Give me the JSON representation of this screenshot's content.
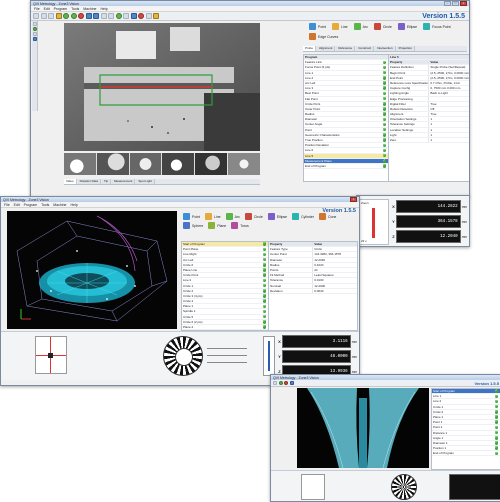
{
  "win1": {
    "title": "QVI Metrology - Zone3 Vision",
    "menu": [
      "File",
      "Edit",
      "Program",
      "Tools",
      "Machine",
      "Help"
    ],
    "version": "Version 1.5.5",
    "features": [
      {
        "label": "Point",
        "icon": "point-icon"
      },
      {
        "label": "Line",
        "icon": "line-icon"
      },
      {
        "label": "Arc",
        "icon": "arc-icon"
      },
      {
        "label": "Circle",
        "icon": "circle-icon"
      },
      {
        "label": "Ellipse",
        "icon": "ellipse-icon"
      },
      {
        "label": "Focus Point",
        "icon": "focus-point-icon"
      },
      {
        "label": "Edge Curves",
        "icon": "edge-curves-icon"
      }
    ],
    "subtabs": [
      "Probe",
      "Alignment",
      "Reference",
      "Construct",
      "Intersection",
      "Projection"
    ],
    "tree_header": "Program",
    "tree": [
      "Feature Link",
      "Focus Point (6 pts)",
      "Line 1",
      "Line 2",
      "Arc Left",
      "Line 3",
      "Best Point",
      "Flat Point",
      "Circle Point",
      "Outer Point",
      "Radius",
      "Diameter",
      "Center Angle",
      "Point",
      "Geometric Characteristics",
      "True Position",
      "Position Deviation",
      "Line 6",
      "Line 5",
      "Measurement Plane",
      "End of Program"
    ],
    "prop_title": "Line 5",
    "props": [
      [
        "Property",
        "Value"
      ],
      [
        "Feature Definition",
        "Single Probe (Set/Repeat)"
      ],
      [
        "Begin Point",
        "(2.5,-2500, 2,5m, 0.0000 mm)"
      ],
      [
        "End Point",
        "(2.5,-2500, 2,5m, 0.0000 mm)"
      ],
      [
        "Reference Loss Specification",
        "0.7 Ohm, Profile, 0 Hz"
      ],
      [
        "Capture Config",
        "0, 7500 mm  0.000 mm"
      ],
      [
        "Lighting Angle",
        "Back to Light"
      ],
      [
        "Edge Processing",
        ""
      ],
      [
        "Digital Filter",
        "True"
      ],
      [
        "Robust Detection",
        "Off"
      ],
      [
        "Alignment",
        "True"
      ],
      [
        "Orientation Settings",
        "1"
      ],
      [
        "Tolerance Settings",
        "1"
      ],
      [
        "Location Settings",
        "1"
      ],
      [
        "Light",
        "1"
      ],
      [
        "Zero",
        "1"
      ]
    ],
    "bottom_tabs": [
      "Video",
      "Rotation Data",
      "Tip",
      "Measurement",
      "Spot Light"
    ],
    "dro": [
      {
        "axis": "X",
        "value": "144.2822",
        "unit": "mm"
      },
      {
        "axis": "Y",
        "value": "364.1578",
        "unit": "mm"
      },
      {
        "axis": "Z",
        "value": "12.2040",
        "unit": "mm"
      }
    ],
    "zoom_label": "Zoom",
    "zoom_value": "23 x"
  },
  "win2": {
    "title": "QVI Metrology - Zone3 Vision",
    "menu": [
      "File",
      "Edit",
      "Program",
      "Tools",
      "Machine",
      "Help"
    ],
    "version": "Version 1.5.5",
    "features": [
      {
        "label": "Point",
        "icon": "point-icon"
      },
      {
        "label": "Line",
        "icon": "line-icon"
      },
      {
        "label": "Arc",
        "icon": "arc-icon"
      },
      {
        "label": "Circle",
        "icon": "circle-icon"
      },
      {
        "label": "Ellipse",
        "icon": "ellipse-icon"
      },
      {
        "label": "Cylinder",
        "icon": "cylinder-icon"
      },
      {
        "label": "Cone",
        "icon": "cone-icon"
      },
      {
        "label": "Sphere",
        "icon": "sphere-icon"
      },
      {
        "label": "Plane",
        "icon": "plane-icon"
      },
      {
        "label": "Torus",
        "icon": "torus-icon"
      }
    ],
    "tree": [
      "Start of Program",
      "Point Plane",
      "Line Right",
      "Arc Left",
      "Circle 6",
      "Plane Line",
      "Circle Point",
      "Line 2",
      "Circle 1",
      "Circle 2",
      "Circle 3 (4 pts)",
      "Circle 4",
      "Plane 1",
      "Spindle 1",
      "Circle 5",
      "Circle 6 (2 pts)",
      "Plane 2",
      "Distance 1",
      "Distance 2",
      "Angle 1",
      "Diameter",
      "Point Angle",
      "Position 1",
      "Flatness",
      "End of Program"
    ],
    "props": [
      [
        "Property",
        "Value"
      ],
      [
        "Feature Type",
        "Circle"
      ],
      [
        "Center Point",
        "144.3282, 364.1578"
      ],
      [
        "Diameter",
        "12.2040"
      ],
      [
        "Radius",
        "6.1020"
      ],
      [
        "Points",
        "24"
      ],
      [
        "Fit Method",
        "Least Squares"
      ],
      [
        "Tolerance",
        "0.0100"
      ],
      [
        "Nominal",
        "12.2000"
      ],
      [
        "Deviation",
        "0.0040"
      ]
    ],
    "dro": [
      {
        "axis": "X",
        "value": "3.1116",
        "unit": "mm"
      },
      {
        "axis": "Y",
        "value": "48.0000",
        "unit": "mm"
      },
      {
        "axis": "Z",
        "value": "13.9936",
        "unit": "mm"
      }
    ]
  },
  "win3": {
    "title": "QVI Metrology - Zone3 Vision",
    "version": "Version 1.5.5",
    "tree": [
      "Start of Program",
      "Line 1",
      "Line 2",
      "Circle 1",
      "Circle 2",
      "Plane 1",
      "Point 1",
      "Point 2",
      "Distance 1",
      "Angle 1",
      "Diameter 1",
      "Position 1",
      "End of Program"
    ]
  }
}
